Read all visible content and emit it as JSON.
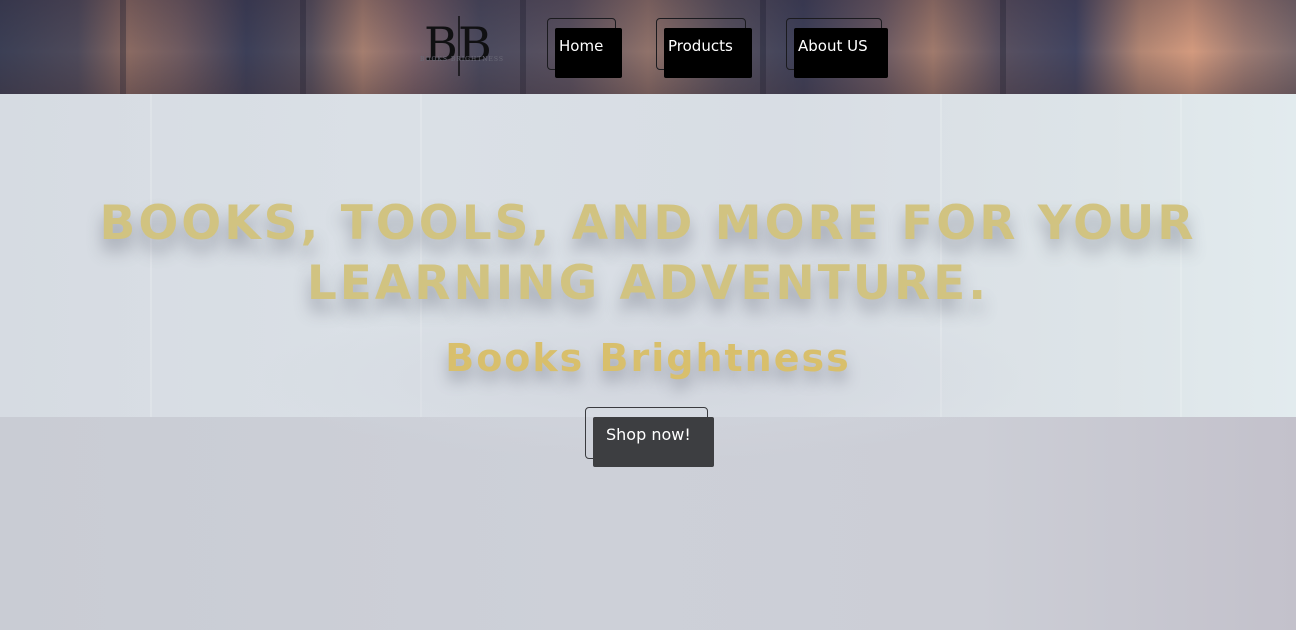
{
  "header": {
    "logo": {
      "monogram": "BB",
      "text": "BOOKS BRIGHTNESS"
    },
    "nav": [
      {
        "label": "Home"
      },
      {
        "label": "Products"
      },
      {
        "label": "About US"
      }
    ]
  },
  "hero": {
    "headline_line1": "BOOKS, TOOLS, AND MORE FOR YOUR",
    "headline_line2": "LEARNING ADVENTURE.",
    "brand_name": "Books Brightness",
    "cta_label": "Shop now!"
  },
  "colors": {
    "headline": "#d1c381",
    "brand_name": "#d8bf6c",
    "nav_button_bg": "#000000",
    "cta_button_bg": "#3d3e41"
  },
  "icons": {
    "logo": "bb-monogram-logo"
  }
}
